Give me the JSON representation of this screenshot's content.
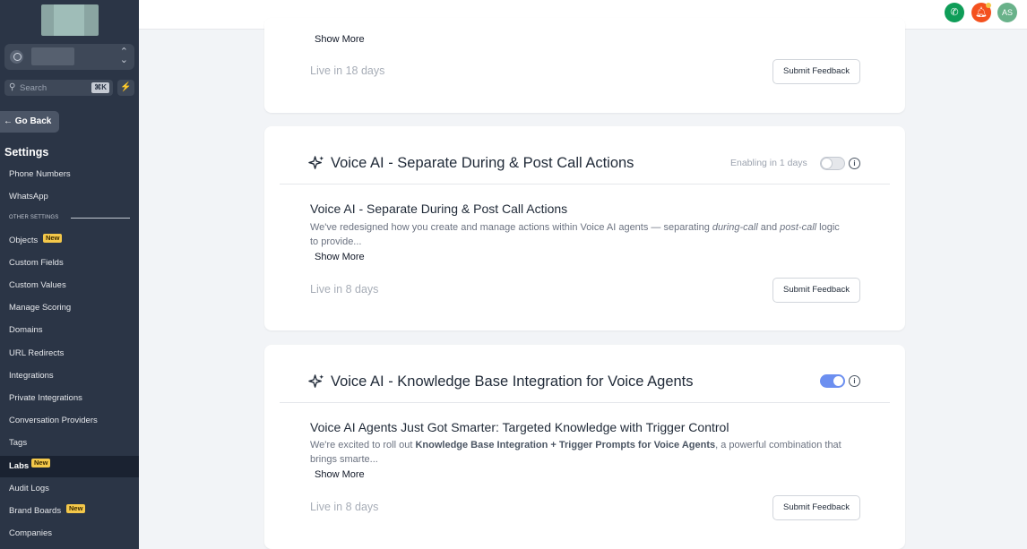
{
  "sidebar": {
    "search_label": "Search",
    "search_shortcut": "⌘K",
    "go_back": "Go Back",
    "settings_title": "Settings",
    "other_settings": "OTHER SETTINGS",
    "new_badge": "New",
    "items": [
      {
        "label": "Phone Numbers"
      },
      {
        "label": "WhatsApp"
      },
      {
        "label": "Objects",
        "badge": "New"
      },
      {
        "label": "Custom Fields"
      },
      {
        "label": "Custom Values"
      },
      {
        "label": "Manage Scoring"
      },
      {
        "label": "Domains"
      },
      {
        "label": "URL Redirects"
      },
      {
        "label": "Integrations"
      },
      {
        "label": "Private Integrations"
      },
      {
        "label": "Conversation Providers"
      },
      {
        "label": "Tags"
      },
      {
        "label": "Labs",
        "badge": "New",
        "active": true
      },
      {
        "label": "Audit Logs"
      },
      {
        "label": "Brand Boards",
        "badge": "New"
      },
      {
        "label": "Companies"
      }
    ]
  },
  "header": {
    "avatar_initials": "AS",
    "phone_icon": "phone-icon",
    "bell_icon": "bell-icon",
    "colors": {
      "phone": "#0f9d58",
      "bell": "#f4511e",
      "avatar": "#69b28a"
    }
  },
  "cards": [
    {
      "show_more": "Show More",
      "live": "Live in 18 days",
      "feedback": "Submit Feedback"
    },
    {
      "title": "Voice AI - Separate During & Post Call Actions",
      "enabling": "Enabling in 1 days",
      "toggle_on": false,
      "subtitle": "Voice AI - Separate During & Post Call Actions",
      "desc_part1": "We've redesigned how you create and manage actions within Voice AI agents — separating ",
      "desc_em1": "during-call",
      "desc_part2": " and ",
      "desc_em2": "post-call",
      "desc_part3": " logic to provide...",
      "show_more": "Show More",
      "live": "Live in 8 days",
      "feedback": "Submit Feedback"
    },
    {
      "title": "Voice AI - Knowledge Base Integration for Voice Agents",
      "toggle_on": true,
      "subtitle": "Voice AI Agents Just Got Smarter: Targeted Knowledge with Trigger Control",
      "desc_part1": "We're excited to roll out ",
      "desc_bold": "Knowledge Base Integration + Trigger Prompts for Voice Agents",
      "desc_part2": ", a powerful combination that brings smarte...",
      "show_more": "Show More",
      "live": "Live in 8 days",
      "feedback": "Submit Feedback"
    }
  ],
  "accent_color": "#6c8ff0"
}
